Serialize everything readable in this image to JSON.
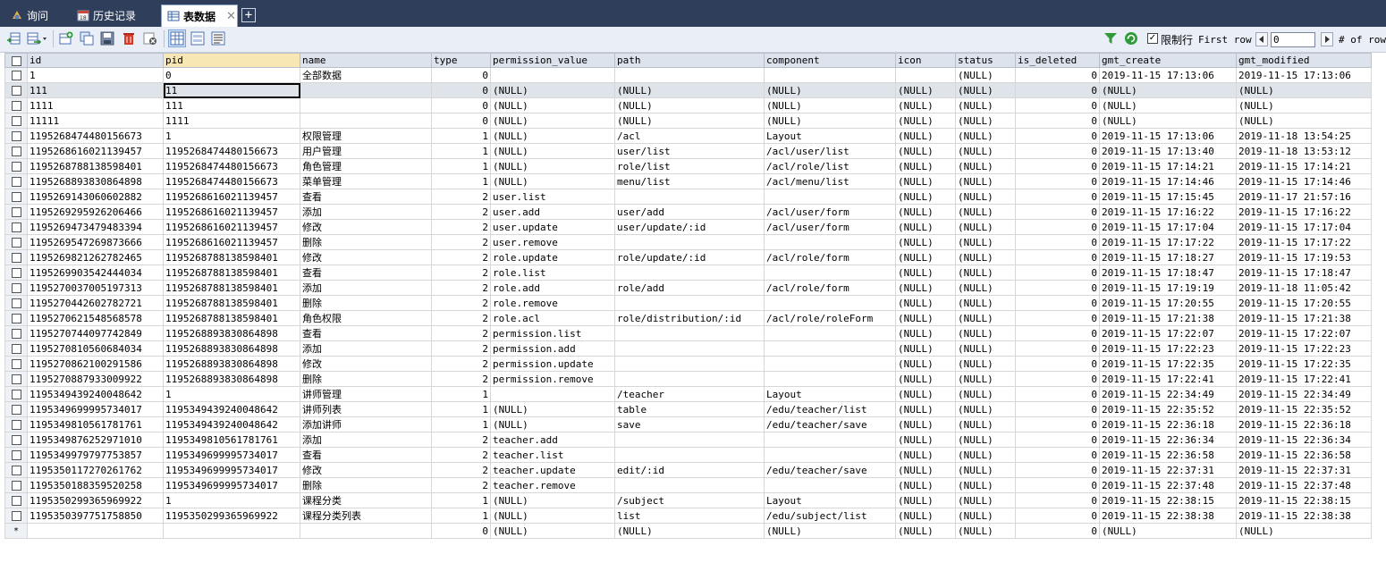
{
  "tabs": [
    {
      "label": "询问",
      "icon": "query-icon"
    },
    {
      "label": "历史记录",
      "icon": "history-icon"
    },
    {
      "label": "表数据",
      "icon": "table-data-icon",
      "active": true,
      "close": "✕"
    }
  ],
  "tab_add": "+",
  "toolbar": {
    "limit_label": "限制行",
    "limit_checked": true,
    "first_row_label": "First row",
    "first_row_value": "0",
    "rows_label": "# of rows"
  },
  "columns": [
    "id",
    "pid",
    "name",
    "type",
    "permission_value",
    "path",
    "component",
    "icon",
    "status",
    "is_deleted",
    "gmt_create",
    "gmt_modified"
  ],
  "rows": [
    [
      "1",
      "0",
      "全部数据",
      "0",
      "",
      "",
      "",
      "",
      "(NULL)",
      "0",
      "2019-11-15 17:13:06",
      "2019-11-15 17:13:06"
    ],
    [
      "111",
      "11",
      "",
      "0",
      "(NULL)",
      "(NULL)",
      "(NULL)",
      "(NULL)",
      "(NULL)",
      "0",
      "(NULL)",
      "(NULL)"
    ],
    [
      "1111",
      "111",
      "",
      "0",
      "(NULL)",
      "(NULL)",
      "(NULL)",
      "(NULL)",
      "(NULL)",
      "0",
      "(NULL)",
      "(NULL)"
    ],
    [
      "11111",
      "1111",
      "",
      "0",
      "(NULL)",
      "(NULL)",
      "(NULL)",
      "(NULL)",
      "(NULL)",
      "0",
      "(NULL)",
      "(NULL)"
    ],
    [
      "1195268474480156673",
      "1",
      "权限管理",
      "1",
      "(NULL)",
      "/acl",
      "Layout",
      "(NULL)",
      "(NULL)",
      "0",
      "2019-11-15 17:13:06",
      "2019-11-18 13:54:25"
    ],
    [
      "1195268616021139457",
      "1195268474480156673",
      "用户管理",
      "1",
      "(NULL)",
      "user/list",
      "/acl/user/list",
      "(NULL)",
      "(NULL)",
      "0",
      "2019-11-15 17:13:40",
      "2019-11-18 13:53:12"
    ],
    [
      "1195268788138598401",
      "1195268474480156673",
      "角色管理",
      "1",
      "(NULL)",
      "role/list",
      "/acl/role/list",
      "(NULL)",
      "(NULL)",
      "0",
      "2019-11-15 17:14:21",
      "2019-11-15 17:14:21"
    ],
    [
      "1195268893830864898",
      "1195268474480156673",
      "菜单管理",
      "1",
      "(NULL)",
      "menu/list",
      "/acl/menu/list",
      "(NULL)",
      "(NULL)",
      "0",
      "2019-11-15 17:14:46",
      "2019-11-15 17:14:46"
    ],
    [
      "1195269143060602882",
      "1195268616021139457",
      "查看",
      "2",
      "user.list",
      "",
      "",
      "(NULL)",
      "(NULL)",
      "0",
      "2019-11-15 17:15:45",
      "2019-11-17 21:57:16"
    ],
    [
      "1195269295926206466",
      "1195268616021139457",
      "添加",
      "2",
      "user.add",
      "user/add",
      "/acl/user/form",
      "(NULL)",
      "(NULL)",
      "0",
      "2019-11-15 17:16:22",
      "2019-11-15 17:16:22"
    ],
    [
      "1195269473479483394",
      "1195268616021139457",
      "修改",
      "2",
      "user.update",
      "user/update/:id",
      "/acl/user/form",
      "(NULL)",
      "(NULL)",
      "0",
      "2019-11-15 17:17:04",
      "2019-11-15 17:17:04"
    ],
    [
      "1195269547269873666",
      "1195268616021139457",
      "删除",
      "2",
      "user.remove",
      "",
      "",
      "(NULL)",
      "(NULL)",
      "0",
      "2019-11-15 17:17:22",
      "2019-11-15 17:17:22"
    ],
    [
      "1195269821262782465",
      "1195268788138598401",
      "修改",
      "2",
      "role.update",
      "role/update/:id",
      "/acl/role/form",
      "(NULL)",
      "(NULL)",
      "0",
      "2019-11-15 17:18:27",
      "2019-11-15 17:19:53"
    ],
    [
      "1195269903542444034",
      "1195268788138598401",
      "查看",
      "2",
      "role.list",
      "",
      "",
      "(NULL)",
      "(NULL)",
      "0",
      "2019-11-15 17:18:47",
      "2019-11-15 17:18:47"
    ],
    [
      "1195270037005197313",
      "1195268788138598401",
      "添加",
      "2",
      "role.add",
      "role/add",
      "/acl/role/form",
      "(NULL)",
      "(NULL)",
      "0",
      "2019-11-15 17:19:19",
      "2019-11-18 11:05:42"
    ],
    [
      "1195270442602782721",
      "1195268788138598401",
      "删除",
      "2",
      "role.remove",
      "",
      "",
      "(NULL)",
      "(NULL)",
      "0",
      "2019-11-15 17:20:55",
      "2019-11-15 17:20:55"
    ],
    [
      "1195270621548568578",
      "1195268788138598401",
      "角色权限",
      "2",
      "role.acl",
      "role/distribution/:id",
      "/acl/role/roleForm",
      "(NULL)",
      "(NULL)",
      "0",
      "2019-11-15 17:21:38",
      "2019-11-15 17:21:38"
    ],
    [
      "1195270744097742849",
      "1195268893830864898",
      "查看",
      "2",
      "permission.list",
      "",
      "",
      "(NULL)",
      "(NULL)",
      "0",
      "2019-11-15 17:22:07",
      "2019-11-15 17:22:07"
    ],
    [
      "1195270810560684034",
      "1195268893830864898",
      "添加",
      "2",
      "permission.add",
      "",
      "",
      "(NULL)",
      "(NULL)",
      "0",
      "2019-11-15 17:22:23",
      "2019-11-15 17:22:23"
    ],
    [
      "1195270862100291586",
      "1195268893830864898",
      "修改",
      "2",
      "permission.update",
      "",
      "",
      "(NULL)",
      "(NULL)",
      "0",
      "2019-11-15 17:22:35",
      "2019-11-15 17:22:35"
    ],
    [
      "1195270887933009922",
      "1195268893830864898",
      "删除",
      "2",
      "permission.remove",
      "",
      "",
      "(NULL)",
      "(NULL)",
      "0",
      "2019-11-15 17:22:41",
      "2019-11-15 17:22:41"
    ],
    [
      "1195349439240048642",
      "1",
      "讲师管理",
      "1",
      "",
      "/teacher",
      "Layout",
      "(NULL)",
      "(NULL)",
      "0",
      "2019-11-15 22:34:49",
      "2019-11-15 22:34:49"
    ],
    [
      "1195349699995734017",
      "1195349439240048642",
      "讲师列表",
      "1",
      "(NULL)",
      "table",
      "/edu/teacher/list",
      "(NULL)",
      "(NULL)",
      "0",
      "2019-11-15 22:35:52",
      "2019-11-15 22:35:52"
    ],
    [
      "1195349810561781761",
      "1195349439240048642",
      "添加讲师",
      "1",
      "(NULL)",
      "save",
      "/edu/teacher/save",
      "(NULL)",
      "(NULL)",
      "0",
      "2019-11-15 22:36:18",
      "2019-11-15 22:36:18"
    ],
    [
      "1195349876252971010",
      "1195349810561781761",
      "添加",
      "2",
      "teacher.add",
      "",
      "",
      "(NULL)",
      "(NULL)",
      "0",
      "2019-11-15 22:36:34",
      "2019-11-15 22:36:34"
    ],
    [
      "1195349979797753857",
      "1195349699995734017",
      "查看",
      "2",
      "teacher.list",
      "",
      "",
      "(NULL)",
      "(NULL)",
      "0",
      "2019-11-15 22:36:58",
      "2019-11-15 22:36:58"
    ],
    [
      "1195350117270261762",
      "1195349699995734017",
      "修改",
      "2",
      "teacher.update",
      "edit/:id",
      "/edu/teacher/save",
      "(NULL)",
      "(NULL)",
      "0",
      "2019-11-15 22:37:31",
      "2019-11-15 22:37:31"
    ],
    [
      "1195350188359520258",
      "1195349699995734017",
      "删除",
      "2",
      "teacher.remove",
      "",
      "",
      "(NULL)",
      "(NULL)",
      "0",
      "2019-11-15 22:37:48",
      "2019-11-15 22:37:48"
    ],
    [
      "1195350299365969922",
      "1",
      "课程分类",
      "1",
      "(NULL)",
      "/subject",
      "Layout",
      "(NULL)",
      "(NULL)",
      "0",
      "2019-11-15 22:38:15",
      "2019-11-15 22:38:15"
    ],
    [
      "1195350397751758850",
      "1195350299365969922",
      "课程分类列表",
      "1",
      "(NULL)",
      "list",
      "/edu/subject/list",
      "(NULL)",
      "(NULL)",
      "0",
      "2019-11-15 22:38:38",
      "2019-11-15 22:38:38"
    ]
  ],
  "new_row_marker": "*",
  "new_row": [
    "",
    "",
    "",
    "0",
    "(NULL)",
    "(NULL)",
    "(NULL)",
    "(NULL)",
    "(NULL)",
    "0",
    "(NULL)",
    "(NULL)"
  ]
}
